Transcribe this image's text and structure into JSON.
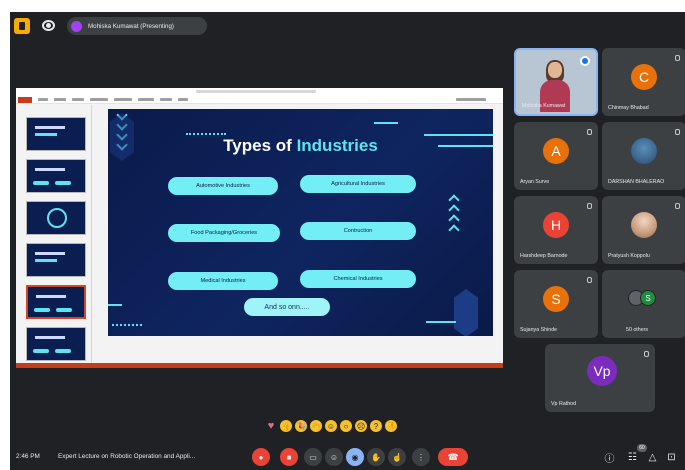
{
  "topbar": {
    "presenter_label": "Mohiska Kumawat (Presenting)"
  },
  "slide": {
    "title_part1": "Types of ",
    "title_part2": "Industries",
    "items": [
      "Automotive Industries",
      "Agricultural Industries",
      "Food Packaging/Groceries",
      "Contruction",
      "Medical Industries",
      "Chemical Industries"
    ],
    "more": "And so onn....."
  },
  "participants": [
    {
      "name": "Mohiska Kumawat",
      "initial": "",
      "color": "",
      "kind": "speaker"
    },
    {
      "name": "Chinmay Bhabad",
      "initial": "C",
      "color": "#e8710a"
    },
    {
      "name": "Aryan Surve",
      "initial": "A",
      "color": "#e8710a"
    },
    {
      "name": "DARSHAN BHALERAO",
      "initial": "",
      "color": "",
      "kind": "photo"
    },
    {
      "name": "Harshdeep Barnode",
      "initial": "H",
      "color": "#ea4335"
    },
    {
      "name": "Pratyush Koppolu",
      "initial": "",
      "color": "",
      "kind": "photo2"
    },
    {
      "name": "Sujanya Shinde",
      "initial": "S",
      "color": "#e8710a"
    },
    {
      "name": "50 others",
      "initial": "S",
      "color": "#1e8e3e",
      "kind": "others"
    },
    {
      "name": "Vp Rathod",
      "initial": "Vp",
      "color": "#7b2cbf"
    }
  ],
  "bottombar": {
    "time": "2:46 PM",
    "meeting_title": "Expert Lecture on Robotic Operation and Appli...",
    "participant_count": "60"
  },
  "icons": {
    "mic": "mic-icon",
    "camera": "camera-icon",
    "captions": "captions-icon",
    "reactions": "emoji-icon",
    "present": "present-icon",
    "raise_hand": "hand-icon",
    "more": "more-icon",
    "end_call": "end-call-icon",
    "info": "info-icon",
    "people": "people-icon",
    "activities": "activities-icon"
  },
  "colors": {
    "background": "#202124",
    "tile": "#3c4043",
    "accent_cyan": "#5fe3f0",
    "slide_navy": "#0a1a4a",
    "end_call_red": "#ea4335"
  }
}
